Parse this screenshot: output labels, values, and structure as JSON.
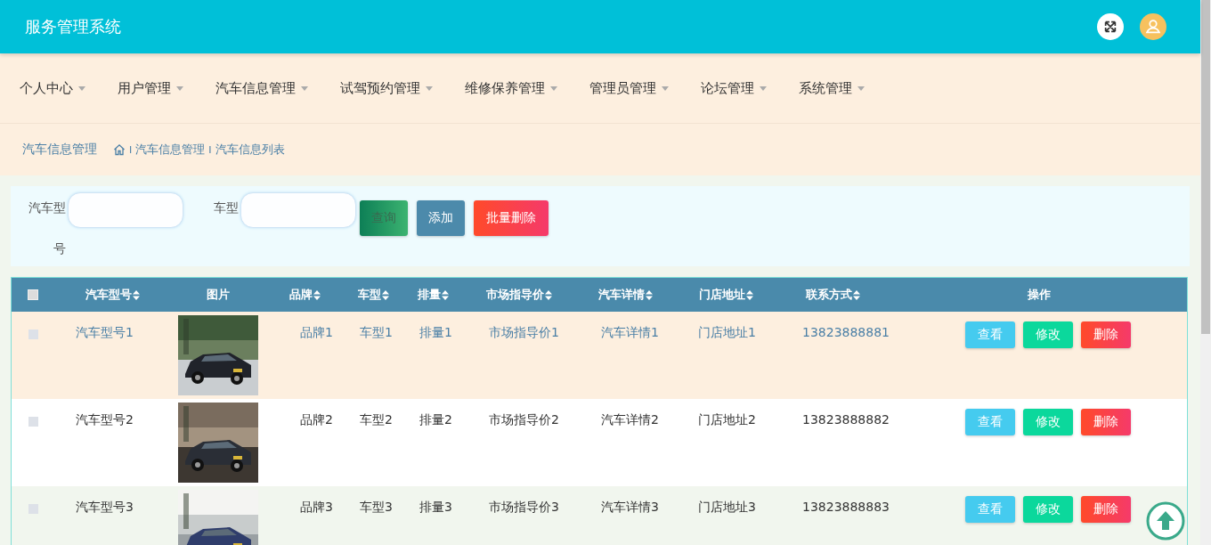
{
  "header": {
    "title": "服务管理系统"
  },
  "nav": [
    {
      "label": "个人中心"
    },
    {
      "label": "用户管理"
    },
    {
      "label": "汽车信息管理"
    },
    {
      "label": "试驾预约管理"
    },
    {
      "label": "维修保养管理"
    },
    {
      "label": "管理员管理"
    },
    {
      "label": "论坛管理"
    },
    {
      "label": "系统管理"
    }
  ],
  "breadcrumb": {
    "title": "汽车信息管理",
    "path": [
      {
        "separator": "I",
        "label": "汽车信息管理"
      },
      {
        "separator": "I",
        "label": "汽车信息列表"
      }
    ]
  },
  "search": {
    "fields": [
      {
        "label": "汽车型号"
      },
      {
        "label": "车型"
      }
    ],
    "buttons": [
      {
        "label": "查询",
        "kind": "query"
      },
      {
        "label": "添加",
        "kind": "add"
      },
      {
        "label": "批量删除",
        "kind": "delete"
      }
    ]
  },
  "table": {
    "header_checked": false,
    "columns": [
      {
        "label": "汽车型号",
        "sortable": true
      },
      {
        "label": "图片",
        "sortable": false
      },
      {
        "label": "品牌",
        "sortable": true
      },
      {
        "label": "车型",
        "sortable": true
      },
      {
        "label": "排量",
        "sortable": true
      },
      {
        "label": "市场指导价",
        "sortable": true
      },
      {
        "label": "汽车详情",
        "sortable": true
      },
      {
        "label": "门店地址",
        "sortable": true
      },
      {
        "label": "联系方式",
        "sortable": true
      },
      {
        "label": "操作",
        "sortable": false
      }
    ],
    "rows": [
      {
        "checked": false,
        "highlighted": true,
        "cells": [
          "汽车型号1",
          "",
          "品牌1",
          "车型1",
          "排量1",
          "市场指导价1",
          "汽车详情1",
          "门店地址1",
          "13823888881"
        ],
        "actions": [
          {
            "label": "查看",
            "kind": "view"
          },
          {
            "label": "修改",
            "kind": "edit"
          },
          {
            "label": "删除",
            "kind": "delete"
          }
        ]
      },
      {
        "checked": false,
        "highlighted": false,
        "cells": [
          "汽车型号2",
          "",
          "品牌2",
          "车型2",
          "排量2",
          "市场指导价2",
          "汽车详情2",
          "门店地址2",
          "13823888882"
        ],
        "actions": [
          {
            "label": "查看",
            "kind": "view"
          },
          {
            "label": "修改",
            "kind": "edit"
          },
          {
            "label": "删除",
            "kind": "delete"
          }
        ]
      },
      {
        "checked": false,
        "highlighted": false,
        "cells": [
          "汽车型号3",
          "",
          "品牌3",
          "车型3",
          "排量3",
          "市场指导价3",
          "汽车详情3",
          "门店地址3",
          "13823888883"
        ],
        "actions": [
          {
            "label": "查看",
            "kind": "view"
          },
          {
            "label": "修改",
            "kind": "edit"
          },
          {
            "label": "删除",
            "kind": "delete"
          }
        ]
      }
    ]
  }
}
